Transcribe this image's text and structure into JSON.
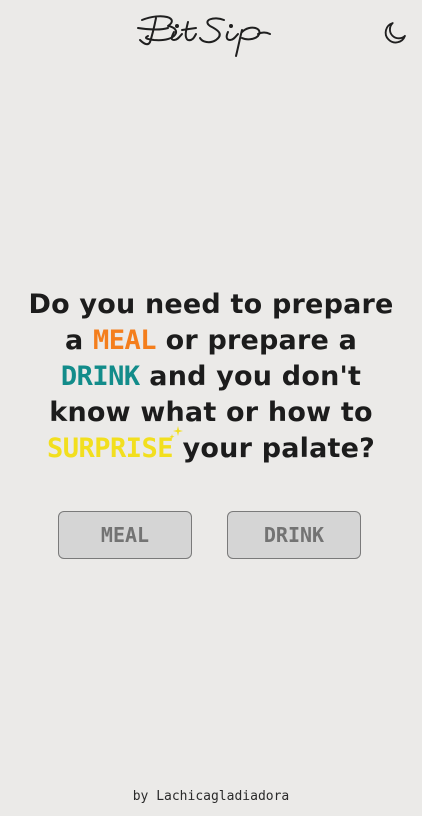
{
  "app": {
    "logo_text": "BitSip"
  },
  "header": {
    "theme_toggle_icon": "moon-icon"
  },
  "hero": {
    "line1": "Do you need to prepare",
    "line2_pre": "a ",
    "meal_word": "MEAL",
    "line2_post": " or prepare a",
    "drink_word": "DRINK",
    "line3_post": " and you don't",
    "line4": "know what or how to",
    "surprise_word": "SURPRISE",
    "line5_post": " your palate?",
    "sparkle_icon": "sparkle-icon"
  },
  "buttons": {
    "meal_label": "MEAL",
    "drink_label": "DRINK"
  },
  "footer": {
    "credit": "by Lachicagladiadora"
  },
  "colors": {
    "background": "#ebeae8",
    "meal": "#f47e1c",
    "drink": "#128c8a",
    "surprise": "#f2df1e",
    "button_bg": "#d5d5d5",
    "button_text": "#737373"
  }
}
